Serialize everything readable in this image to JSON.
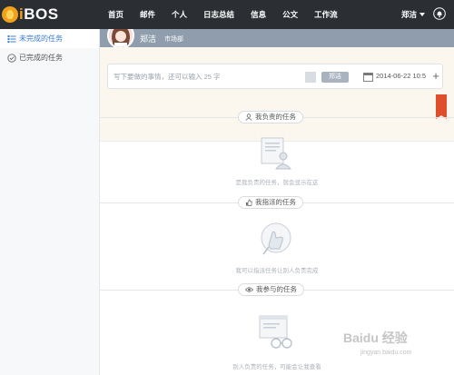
{
  "app": {
    "logo_text_i": "i",
    "logo_text_rest": "BOS"
  },
  "nav": {
    "items": [
      "首页",
      "邮件",
      "个人",
      "日志总结",
      "信息",
      "公文",
      "工作流"
    ]
  },
  "user": {
    "name": "郑洁"
  },
  "sidebar": {
    "items": [
      {
        "label": "未完成的任务",
        "icon": "task-list-icon",
        "active": true
      },
      {
        "label": "已完成的任务",
        "icon": "check-circle-icon",
        "active": false
      }
    ]
  },
  "profile": {
    "name": "郑洁",
    "dept": "市场部"
  },
  "compose": {
    "placeholder": "写下要做的事情，还可以输入 25 字",
    "assignee": "郑洁",
    "date": "2014-06-22 10:5",
    "add_label": "+"
  },
  "sections": [
    {
      "title": "我负责的任务",
      "empty": "是我负责的任务，就会显示在这",
      "icon": "user-icon",
      "illustration": "document-person-illustration"
    },
    {
      "title": "我指派的任务",
      "empty": "我可以指派任务让别人负责完成",
      "icon": "thumb-icon",
      "illustration": "assign-hand-illustration"
    },
    {
      "title": "我参与的任务",
      "empty": "别人负责的任务，可能会让我查看",
      "icon": "eye-icon",
      "illustration": "browser-glasses-illustration"
    }
  ],
  "watermark": {
    "brand": "Baidu 经验",
    "url": "jingyan.baidu.com"
  },
  "colors": {
    "topbar": "#2b2e33",
    "accent": "#3a7bd5",
    "ribbon": "#e04f2b",
    "logo": "#f2a11a"
  }
}
